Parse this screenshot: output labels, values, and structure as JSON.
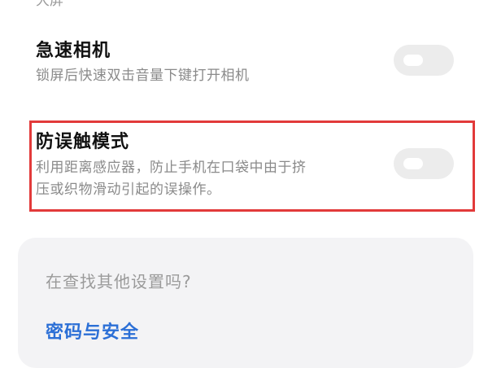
{
  "top_partial_text": "大屏",
  "settings": [
    {
      "title": "急速相机",
      "description_lines": [
        "锁屏后快速双击音量下键打开相机"
      ],
      "enabled": false
    },
    {
      "title": "防误触模式",
      "description_lines": [
        "利用距离感应器，防止手机在口袋中由于挤",
        "压或织物滑动引起的误操作。"
      ],
      "enabled": false
    }
  ],
  "search_card": {
    "question": "在查找其他设置吗?",
    "link": "密码与安全"
  },
  "colors": {
    "highlight": "#e23a3a",
    "link": "#2b6fd6",
    "toggle_off": "#ececec"
  }
}
